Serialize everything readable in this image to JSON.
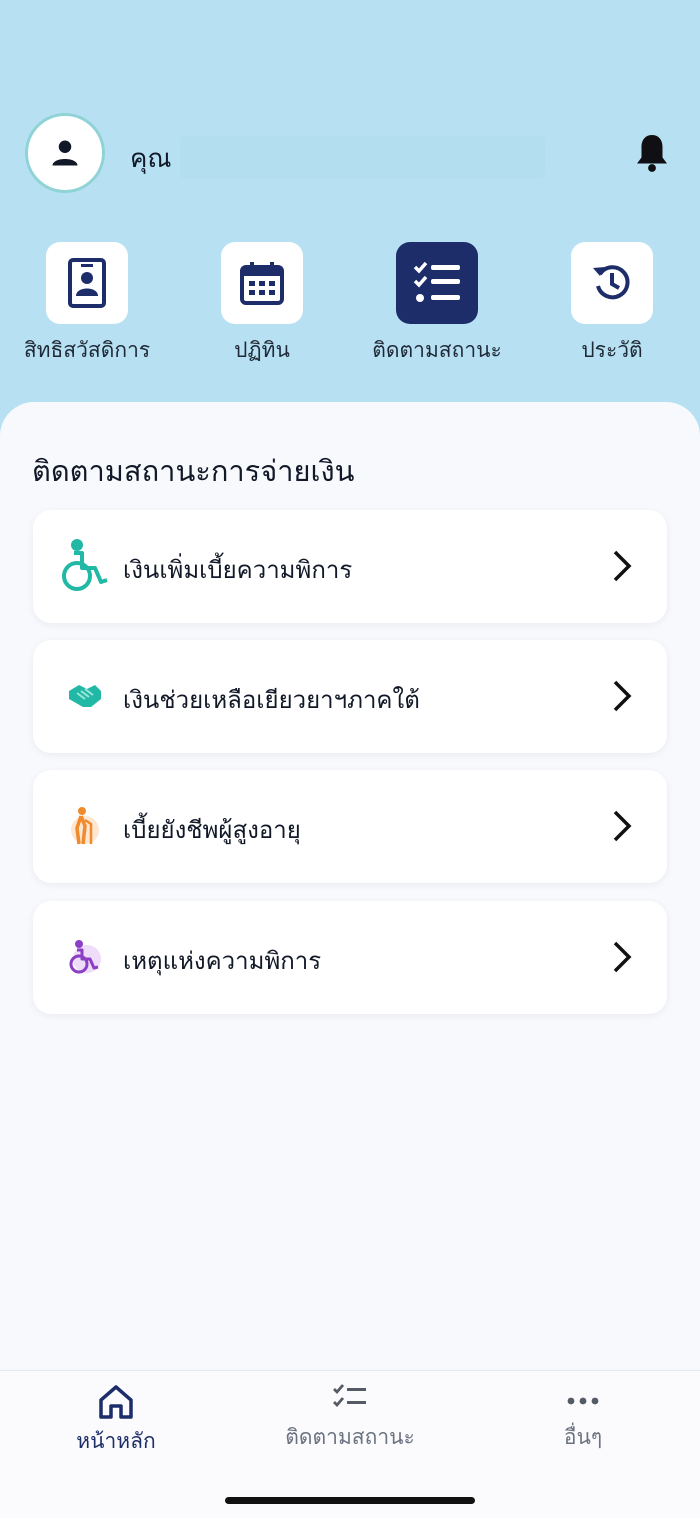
{
  "header": {
    "greeting": "คุณ",
    "avatar_icon": "user-icon",
    "notification_icon": "bell-icon"
  },
  "quick_actions": [
    {
      "label": "สิทธิสวัสดิการ",
      "icon": "id-card-icon",
      "active": false
    },
    {
      "label": "ปฏิทิน",
      "icon": "calendar-icon",
      "active": false
    },
    {
      "label": "ติดตามสถานะ",
      "icon": "checklist-icon",
      "active": true
    },
    {
      "label": "ประวัติ",
      "icon": "history-icon",
      "active": false
    }
  ],
  "main": {
    "title": "ติดตามสถานะการจ่ายเงิน",
    "items": [
      {
        "label": "เงินเพิ่มเบี้ยความพิการ",
        "icon": "wheelchair-icon"
      },
      {
        "label": "เงินช่วยเหลือเยียวยาฯภาคใต้",
        "icon": "handshake-icon"
      },
      {
        "label": "เบี้ยยังชีพผู้สูงอายุ",
        "icon": "elderly-icon"
      },
      {
        "label": "เหตุแห่งความพิการ",
        "icon": "wheelchair-purple-icon"
      }
    ]
  },
  "bottom_nav": [
    {
      "label": "หน้าหลัก",
      "icon": "home-icon",
      "active": true
    },
    {
      "label": "ติดตามสถานะ",
      "icon": "checklist-icon",
      "active": false
    },
    {
      "label": "อื่นๆ",
      "icon": "more-dots-icon",
      "active": false
    }
  ],
  "colors": {
    "header_bg": "#b7e1f2",
    "accent_navy": "#1d2d69",
    "sheet_bg": "#f7f9fc",
    "teal": "#22b8a6",
    "orange": "#f08a2c",
    "purple": "#8a3fc4"
  }
}
